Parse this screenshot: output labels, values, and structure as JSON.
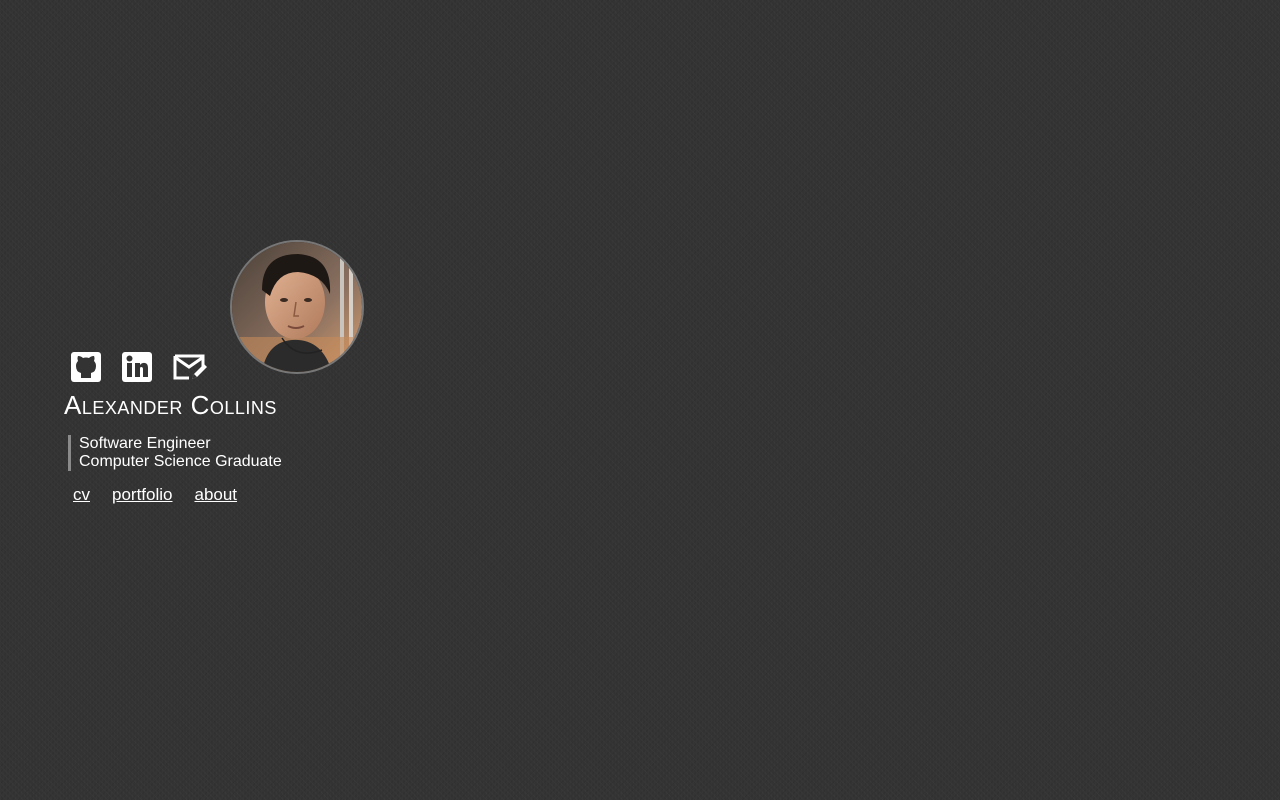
{
  "profile": {
    "name": "Alexander Collins",
    "tagline": [
      "Software Engineer",
      "Computer Science Graduate"
    ],
    "avatar": "profile-photo"
  },
  "social": [
    {
      "icon": "github-icon"
    },
    {
      "icon": "linkedin-icon"
    },
    {
      "icon": "email-icon"
    }
  ],
  "nav": [
    "cv",
    "portfolio",
    "about"
  ],
  "colors": {
    "background": "#333333",
    "text": "#ffffff",
    "accent_border": "#8a8a8a"
  }
}
